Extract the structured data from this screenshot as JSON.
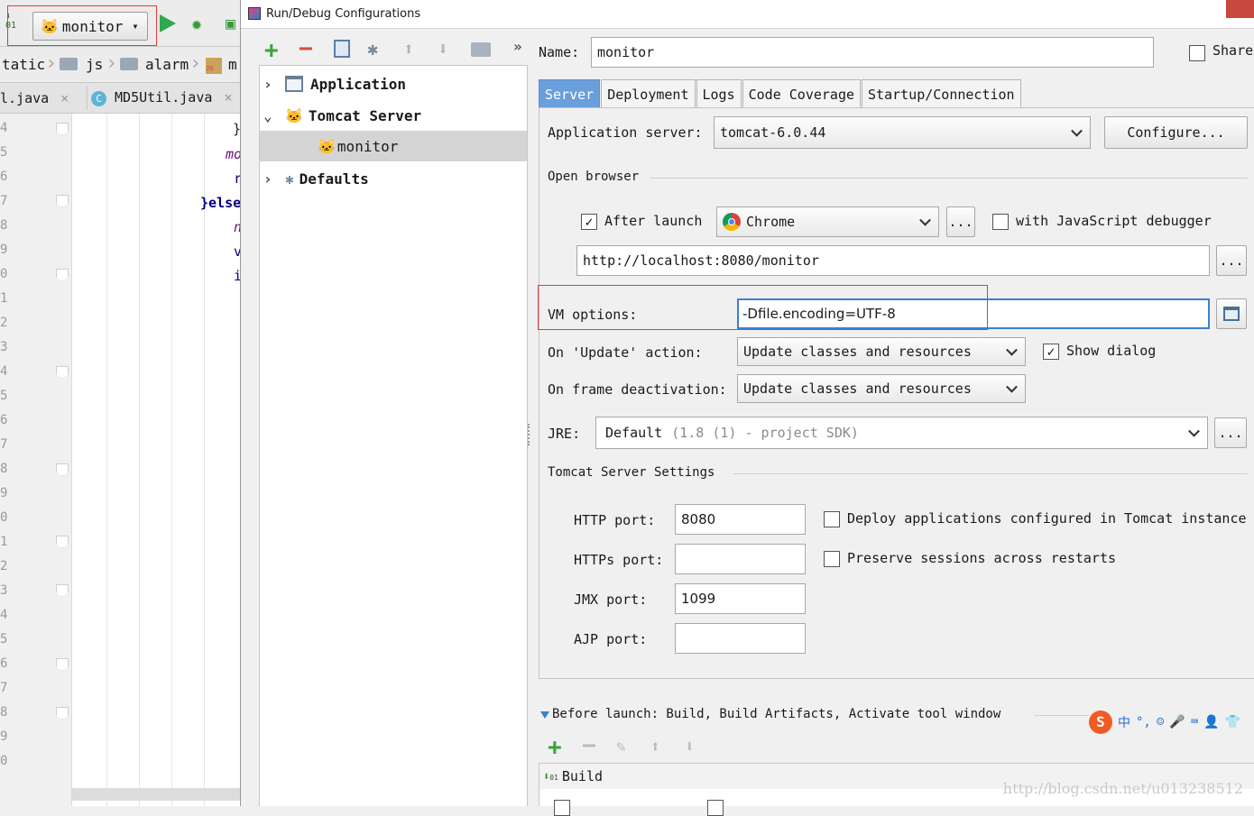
{
  "ide": {
    "run_config": "monitor",
    "breadcrumbs": [
      "tatic",
      "js",
      "alarm",
      "m"
    ],
    "file_tabs": [
      {
        "label": "l.java",
        "close": "×"
      },
      {
        "label": "MD5Util.java",
        "close": "×"
      }
    ],
    "line_numbers": [
      "4",
      "5",
      "6",
      "7",
      "8",
      "9",
      "0",
      "1",
      "2",
      "3",
      "4",
      "5",
      "6",
      "7",
      "8",
      "9",
      "0",
      "1",
      "2",
      "3",
      "4",
      "5",
      "6",
      "7",
      "8",
      "9",
      "0"
    ],
    "code_fragments": [
      "}",
      "mo",
      "r",
      "}else",
      "n",
      "v",
      "i"
    ]
  },
  "dialog": {
    "title": "Run/Debug Configurations",
    "tree": [
      {
        "label": "Application",
        "expanded": false
      },
      {
        "label": "Tomcat Server",
        "expanded": true
      },
      {
        "label": "monitor",
        "selected": true
      },
      {
        "label": "Defaults",
        "expanded": false
      }
    ],
    "name_label": "Name:",
    "name_value": "monitor",
    "share_label": "Share",
    "tabs": [
      "Server",
      "Deployment",
      "Logs",
      "Code Coverage",
      "Startup/Connection"
    ],
    "active_tab": "Server",
    "server": {
      "app_server_label": "Application server:",
      "app_server_value": "tomcat-6.0.44",
      "configure_label": "Configure...",
      "open_browser_label": "Open browser",
      "after_launch_label": "After launch",
      "after_launch_checked": true,
      "browser": "Chrome",
      "browse_btn": "...",
      "js_debugger_label": "with JavaScript debugger",
      "js_debugger_checked": false,
      "url": "http://localhost:8080/monitor",
      "url_btn": "...",
      "vm_options_label": "VM options:",
      "vm_options_value": "-Dfile.encoding=UTF-8",
      "update_action_label": "On 'Update' action:",
      "update_action_value": "Update classes and resources",
      "show_dialog_label": "Show dialog",
      "show_dialog_checked": true,
      "frame_deactivation_label": "On frame deactivation:",
      "frame_deactivation_value": "Update classes and resources",
      "jre_label": "JRE:",
      "jre_value": "Default",
      "jre_hint": "(1.8 (1) - project SDK)",
      "jre_btn": "...",
      "tomcat_settings_label": "Tomcat Server Settings",
      "http_port_label": "HTTP port:",
      "http_port": "8080",
      "https_port_label": "HTTPs port:",
      "https_port": "",
      "jmx_port_label": "JMX port:",
      "jmx_port": "1099",
      "ajp_port_label": "AJP port:",
      "ajp_port": "",
      "deploy_label": "Deploy applications configured in Tomcat instance",
      "deploy_checked": false,
      "preserve_label": "Preserve sessions across restarts",
      "preserve_checked": false
    },
    "before_launch": {
      "label": "Before launch: Build, Build Artifacts, Activate tool window",
      "items": [
        "Build"
      ]
    }
  },
  "overlay": {
    "ime_label": "中",
    "watermark": "http://blog.csdn.net/u013238512"
  },
  "colors": {
    "accent": "#6a9fdc",
    "highlight": "#e63a3a",
    "run_green": "#2fa84f",
    "add_green": "#3aa53a",
    "remove_red": "#d94a3a"
  }
}
